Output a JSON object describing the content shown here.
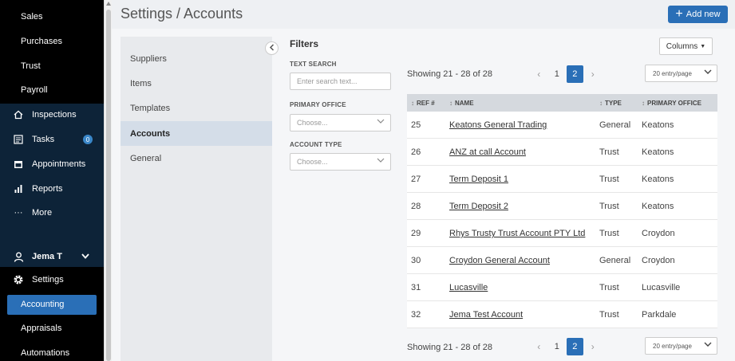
{
  "sidebar": {
    "sub_items_top": [
      "Sales",
      "Purchases",
      "Trust",
      "Payroll"
    ],
    "main_items": [
      {
        "label": "Inspections",
        "icon": "home-search-icon"
      },
      {
        "label": "Tasks",
        "icon": "checklist-icon",
        "badge": "0"
      },
      {
        "label": "Appointments",
        "icon": "calendar-icon"
      },
      {
        "label": "Reports",
        "icon": "bar-chart-icon"
      },
      {
        "label": "More",
        "icon": "ellipsis-icon"
      }
    ],
    "user": {
      "label": "Jema T",
      "icon": "user-icon"
    },
    "settings": {
      "label": "Settings",
      "icon": "gear-icon"
    },
    "settings_children": [
      "Accounting",
      "Appraisals",
      "Automations"
    ]
  },
  "header": {
    "title": "Settings / Accounts",
    "add_label": "Add new"
  },
  "settings_nav": {
    "items": [
      "Suppliers",
      "Items",
      "Templates",
      "Accounts",
      "General"
    ],
    "active": "Accounts"
  },
  "filters": {
    "title": "Filters",
    "text_search_label": "TEXT SEARCH",
    "text_search_placeholder": "Enter search text...",
    "primary_office_label": "PRIMARY OFFICE",
    "primary_office_value": "Choose...",
    "account_type_label": "ACCOUNT TYPE",
    "account_type_value": "Choose..."
  },
  "table_controls": {
    "columns_label": "Columns",
    "showing": "Showing 21 - 28 of 28",
    "pages": [
      "1",
      "2"
    ],
    "current_page": "2",
    "per_page": "20 entry/page"
  },
  "table": {
    "headers": [
      "REF #",
      "NAME",
      "TYPE",
      "PRIMARY OFFICE"
    ],
    "rows": [
      [
        "25",
        "Keatons General Trading",
        "General",
        "Keatons"
      ],
      [
        "26",
        "ANZ at call Account",
        "Trust",
        "Keatons"
      ],
      [
        "27",
        "Term Deposit 1",
        "Trust",
        "Keatons"
      ],
      [
        "28",
        "Term Deposit 2",
        "Trust",
        "Keatons"
      ],
      [
        "29",
        "Rhys Trusty Trust Account PTY Ltd",
        "Trust",
        "Croydon"
      ],
      [
        "30",
        "Croydon General Account",
        "General",
        "Croydon"
      ],
      [
        "31",
        "Lucasville",
        "Trust",
        "Lucasville"
      ],
      [
        "32",
        "Jema Test Account",
        "Trust",
        "Parkdale"
      ]
    ]
  },
  "colors": {
    "accent": "#2a6fb7",
    "sidebar_bg": "#000000",
    "sidebar_navy": "#0d2338"
  }
}
